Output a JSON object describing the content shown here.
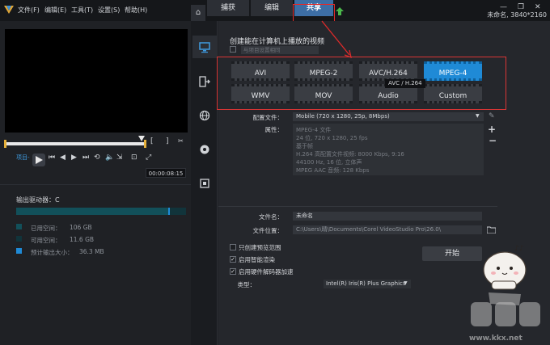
{
  "menu": [
    "文件(F)",
    "编辑(E)",
    "工具(T)",
    "设置(S)",
    "帮助(H)"
  ],
  "tabs": [
    "捕获",
    "编辑",
    "共享"
  ],
  "project": {
    "name": "未命名, 3840*2160"
  },
  "window_controls": [
    "—",
    "❐",
    "✕"
  ],
  "player": {
    "project_label": "项目-",
    "timecode": "00:00:08:15"
  },
  "drive": {
    "label": "输出驱动器：C",
    "used_fraction": 0.9,
    "legend": [
      {
        "label": "已用空间：",
        "value": "106 GB",
        "color": "#12505a"
      },
      {
        "label": "可用空间：",
        "value": "11.6 GB",
        "color": "#11343b"
      },
      {
        "label": "预计输出大小：",
        "value": "36.3 MB",
        "color": "#1f8ad6"
      }
    ]
  },
  "share": {
    "heading": "创建能在计算机上播放的视频",
    "custom_dropdown": "与项目设置相同",
    "formats_row1": [
      "AVI",
      "MPEG-2",
      "AVC/H.264",
      "MPEG-4"
    ],
    "formats_row2": [
      "WMV",
      "MOV",
      "Audio",
      "Custom"
    ],
    "selected_format": "MPEG-4",
    "tooltip": "AVC / H.264",
    "profile_label": "配置文件：",
    "profile_value": "Mobile (720 x 1280, 25p, 8Mbps)",
    "props_label": "属性：",
    "props_lines": [
      "MPEG-4 文件",
      "24 位, 720 x 1280, 25 fps",
      "基于帧",
      "H.264 高配置文件视频: 8000 Kbps, 9:16",
      "44100 Hz, 16 位, 立体声",
      "MPEG AAC 音频: 128 Kbps"
    ],
    "filename_label": "文件名：",
    "filename_value": "未命名",
    "location_label": "文件位置：",
    "location_value": "C:\\Users\\晴\\Documents\\Corel VideoStudio Pro\\26.0\\",
    "option_preview_range": "只创建预览范围",
    "option_smart_render": "启用智能渲染",
    "option_hw_accel": "启用硬件解码器加速",
    "type_label": "类型：",
    "type_value": "Intel(R) Iris(R) Plus Graphics",
    "start_button": "开始"
  },
  "site": {
    "url": "www.kkx.net"
  }
}
